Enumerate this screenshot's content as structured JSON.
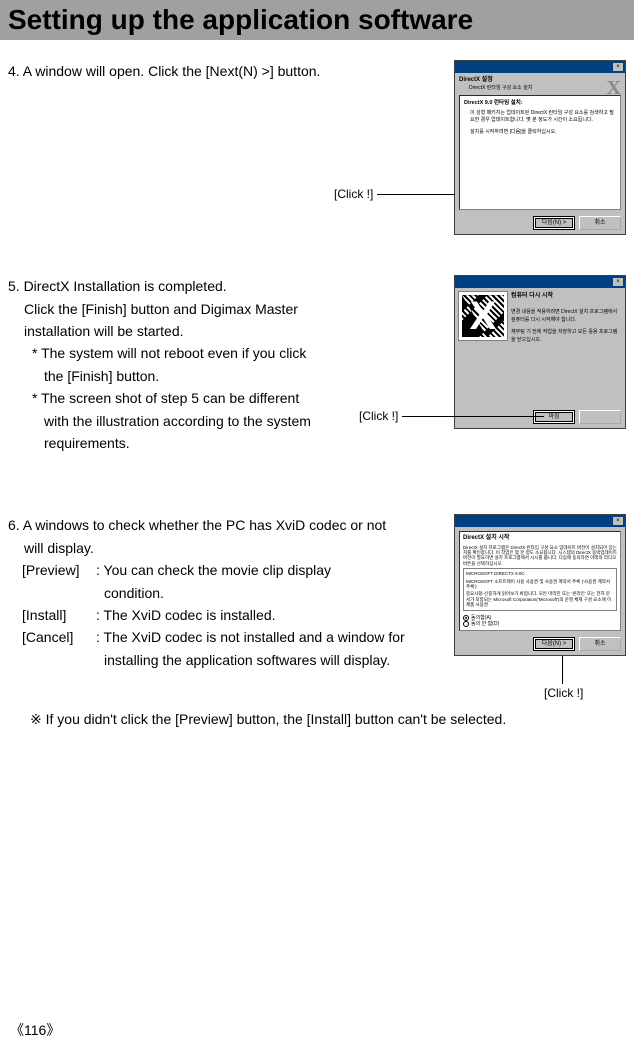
{
  "page_title": "Setting up the application software",
  "step4": {
    "text": "4. A window will open. Click the [Next(N) >] button.",
    "click_label": "[Click !]",
    "dialog": {
      "section_title": "DirectX 설정",
      "section_sub": "DirectX 런타임 구성 요소 설치",
      "body_title": "DirectX 9.0 런타임 설치:",
      "body_line1": "이 성형 패키지는 업데이트된 DirectX 런타임 구성 요소를 검색하고 필요한 경우 업데이트합니다. 몇 분 정도가 시간이 소요됩니다.",
      "body_line2": "",
      "body_line3": "설치를 시작하려면 [다음]을 클릭하십시오.",
      "btn_next": "다음(N) >",
      "btn_cancel": "취소"
    }
  },
  "step5": {
    "line1": "5. DirectX Installation is completed.",
    "line2": "Click the [Finish] button and Digimax Master",
    "line3": "installation will be started.",
    "bullet1a": "* The system will not reboot even if you click",
    "bullet1b": "the [Finish] button.",
    "bullet2a": "* The screen shot of step 5 can be different",
    "bullet2b": "with the illustration according to the system",
    "bullet2c": "requirements.",
    "click_label": "[Click !]",
    "dialog": {
      "heading": "컴퓨터 다시 시작",
      "text1": "변경 내용을 적용하려면 DirectX 설치 프로그램에서 컴퓨터를 다시 시작해야 합니다.",
      "text2": "",
      "text3": "재부팅 기 전에 작업을 저장하고 모든 응용 프로그램을 닫으십시오.",
      "btn_finish": "마침",
      "btn_empty": ""
    }
  },
  "step6": {
    "line1": "6. A windows to check whether the PC has XviD codec or not",
    "line2": "will display.",
    "preview_label": "[Preview]",
    "preview_desc1": ": You can check the movie clip display",
    "preview_desc2": "condition.",
    "install_label": "[Install]",
    "install_desc": ": The XviD codec is installed.",
    "cancel_label": "[Cancel]",
    "cancel_desc1": ": The XviD codec is not installed and a window for",
    "cancel_desc2": "installing the application softwares will display.",
    "click_label": "[Click !]",
    "dialog": {
      "heading": "DirectX 설치 시작",
      "para1": "DirectX 설치 프로그램은 DirectX 런타임 구성 요소 업데이트 버전이 설치되어 있는지를 확인합니다. 이 작업은 몇 분 정도 소요됩니다. 시스템의 DirectX 동박업데이트 버전이 필요하면 설치 프로그램에서 시시를 줍니다. 다음에 동의하면 아래의 라디오 버튼을 선택하십시오.",
      "eula_heading": "MICROSOFT DIRECTX 9.0C",
      "eula_body": "MICROSOFT 소프트웨어 사용 사용권 및 사용권 계약서 추록 ('사용권 계약서 추록')",
      "eula_body2": "중요사항-신중하게 읽어보기 바랍니다. 모든 마라진 또는 '온라인' 또는 전자 문서가 포함되는 Microsoft Corporation('Microsoft')의 운영 체제 구성 요소에 이 제품 사용권",
      "radio_accept": "동의함(A)",
      "radio_decline": "동의 안 함(D)",
      "btn_next": "다음(N) >",
      "btn_cancel": "취소"
    }
  },
  "note": "※ If you didn't click the [Preview] button, the [Install] button can't be selected.",
  "page_number": "116"
}
